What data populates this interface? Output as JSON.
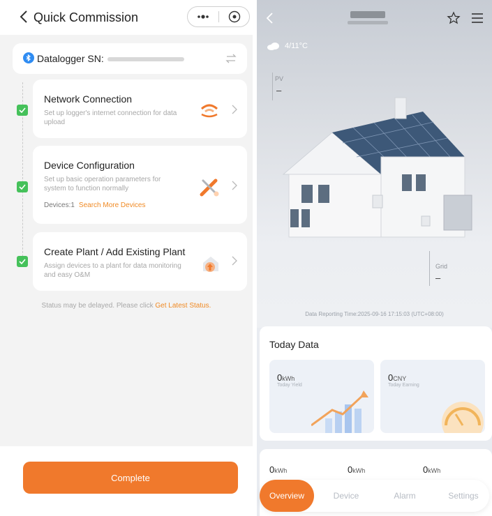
{
  "left": {
    "header": {
      "title": "Quick Commission"
    },
    "logger": {
      "label": "Datalogger SN:"
    },
    "steps": [
      {
        "title": "Network Connection",
        "desc": "Set up logger's internet connection for data upload",
        "icon": "wifi-icon",
        "status": "done"
      },
      {
        "title": "Device Configuration",
        "desc": "Set up basic operation parameters for system to function normally",
        "devices": "Devices:1",
        "link": "Search More Devices",
        "icon": "tools-icon",
        "status": "done"
      },
      {
        "title": "Create Plant / Add Existing Plant",
        "desc": "Assign devices to a plant for data monitoring and easy O&M",
        "icon": "upload-house-icon",
        "status": "done"
      }
    ],
    "status_note": {
      "text": "Status may be delayed. Please click ",
      "link": "Get Latest Status."
    },
    "complete_label": "Complete",
    "accent": "#f0792c"
  },
  "right": {
    "weather": {
      "temp": "4/11°C",
      "icon": "cloud-icon"
    },
    "pv": {
      "label": "PV",
      "value": "–"
    },
    "grid": {
      "label": "Grid",
      "value": "–"
    },
    "report_time": "Data Reporting Time:2025-09-16 17:15:03 (UTC+08:00)",
    "today": {
      "title": "Today Data",
      "yield": {
        "value": "0",
        "unit": "kWh",
        "label": "Today Yield"
      },
      "earning": {
        "value": "0",
        "unit": "CNY",
        "label": "Today Earning"
      }
    },
    "summary": [
      {
        "value": "0",
        "unit": "kWh"
      },
      {
        "value": "0",
        "unit": "kWh"
      },
      {
        "value": "0",
        "unit": "kWh"
      }
    ],
    "tabs": [
      "Overview",
      "Device",
      "Alarm",
      "Settings"
    ],
    "active_tab": "Overview"
  }
}
